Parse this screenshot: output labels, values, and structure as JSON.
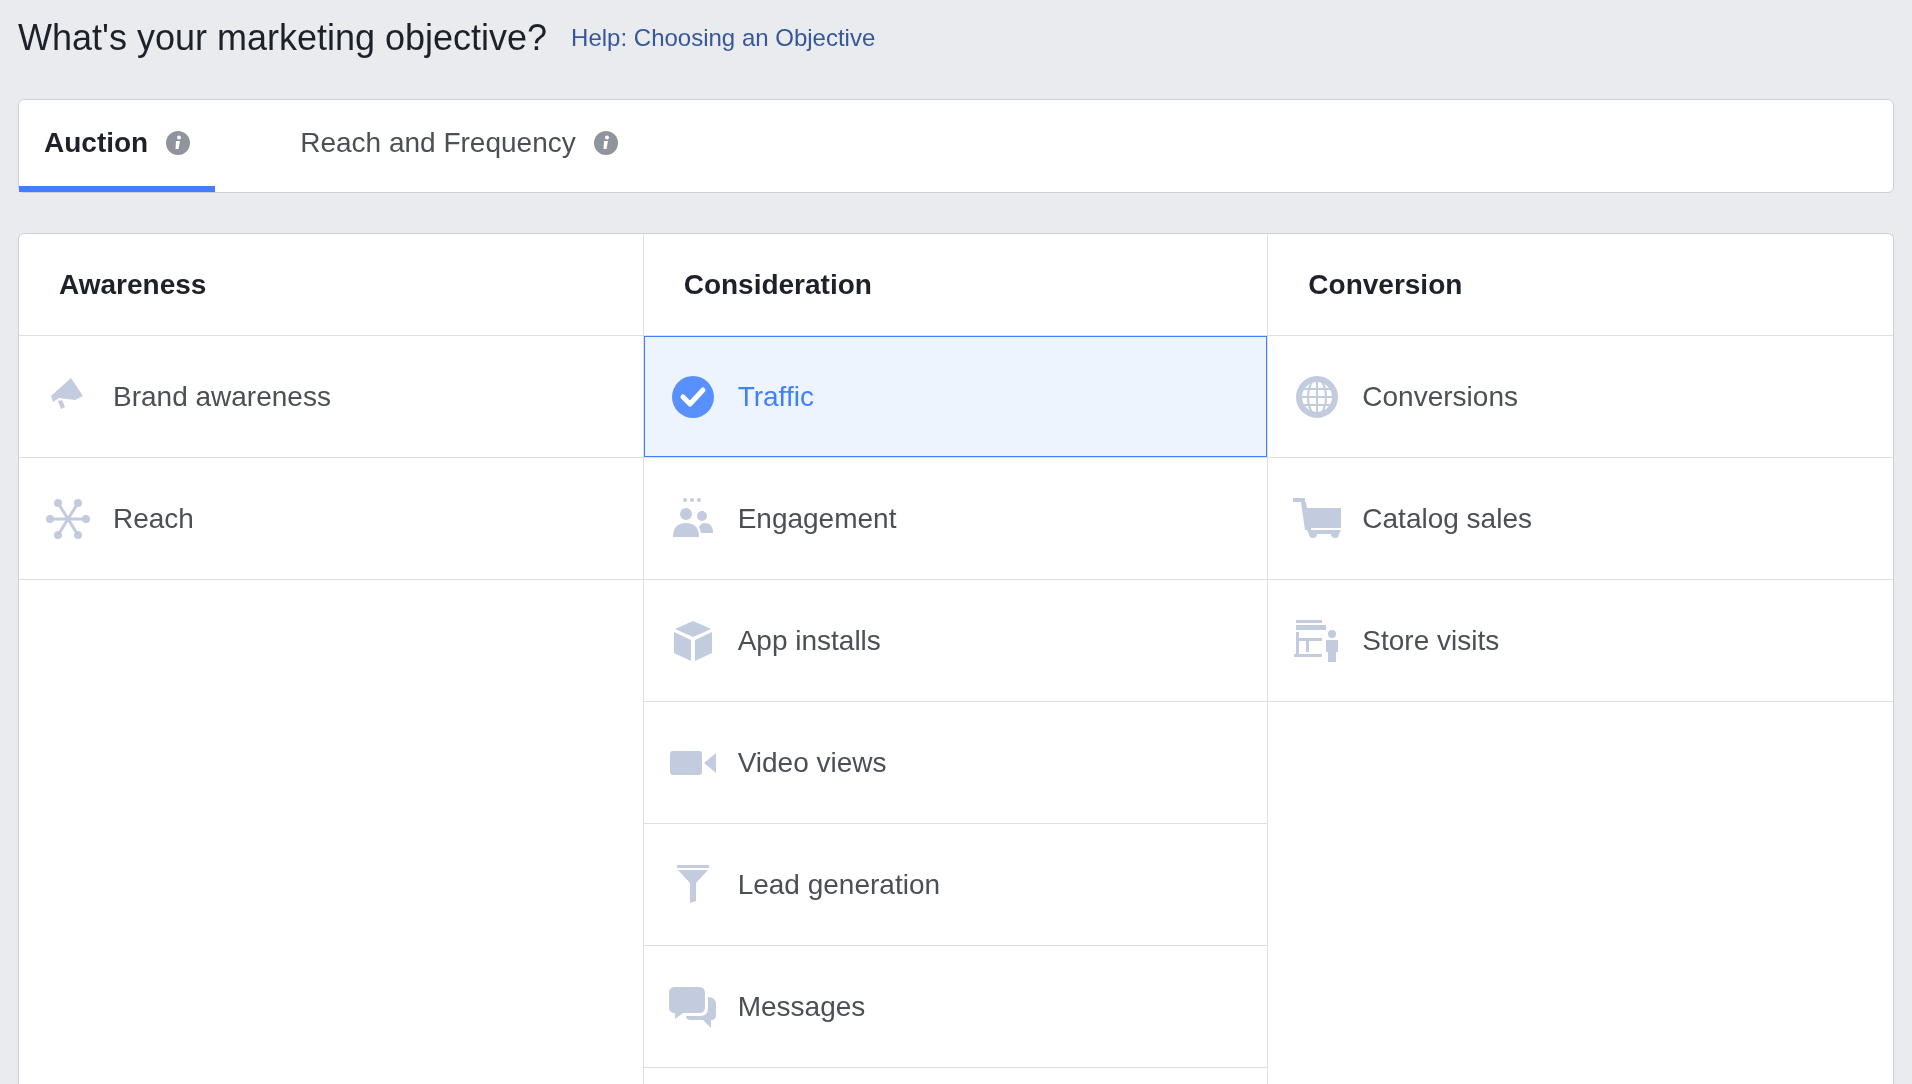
{
  "header": {
    "title": "What's your marketing objective?",
    "help_link": "Help: Choosing an Objective"
  },
  "tabs": [
    {
      "label": "Auction",
      "selected": true
    },
    {
      "label": "Reach and Frequency",
      "selected": false
    }
  ],
  "columns": [
    {
      "heading": "Awareness",
      "items": [
        {
          "label": "Brand awareness",
          "selected": false
        },
        {
          "label": "Reach",
          "selected": false
        }
      ]
    },
    {
      "heading": "Consideration",
      "items": [
        {
          "label": "Traffic",
          "selected": true
        },
        {
          "label": "Engagement",
          "selected": false
        },
        {
          "label": "App installs",
          "selected": false
        },
        {
          "label": "Video views",
          "selected": false
        },
        {
          "label": "Lead generation",
          "selected": false
        },
        {
          "label": "Messages",
          "selected": false
        }
      ]
    },
    {
      "heading": "Conversion",
      "items": [
        {
          "label": "Conversions",
          "selected": false
        },
        {
          "label": "Catalog sales",
          "selected": false
        },
        {
          "label": "Store visits",
          "selected": false
        }
      ]
    }
  ]
}
